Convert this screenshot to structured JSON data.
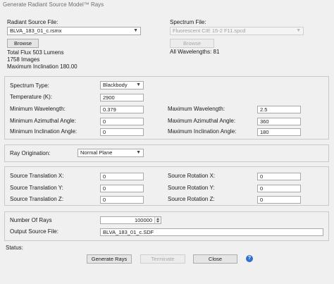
{
  "window": {
    "title": "Generate Radiant Source Model™ Rays"
  },
  "radiant_source": {
    "label": "Radiant Source File:",
    "selected": "BLVA_183_01_c.rsmx",
    "browse_label": "Browse",
    "total_flux": "Total Flux 503 Lumens",
    "images": "1758 Images",
    "max_inclination": "Maximum Inclination 180.00"
  },
  "spectrum_file": {
    "label": "Spectrum File:",
    "selected": "Fluorescent CIE 15-2 F11.spcd",
    "browse_label": "Browse",
    "all_wavelengths": "All Wavelengths: 81"
  },
  "spectrum": {
    "type_label": "Spectrum Type:",
    "type_value": "Blackbody",
    "temperature_label": "Temperature (K):",
    "temperature_value": "2900",
    "min_wavelength_label": "Minimum Wavelength:",
    "min_wavelength_value": "0.379",
    "max_wavelength_label": "Maximum Wavelength:",
    "max_wavelength_value": "2.5",
    "min_azimuthal_label": "Minimum Azimuthal Angle:",
    "min_azimuthal_value": "0",
    "max_azimuthal_label": "Maximum Azimuthal Angle:",
    "max_azimuthal_value": "360",
    "min_inclination_label": "Minimum Inclination Angle:",
    "min_inclination_value": "0",
    "max_inclination_label": "Maximum Inclination Angle:",
    "max_inclination_value": "180"
  },
  "ray_origination": {
    "label": "Ray Origination:",
    "value": "Normal Plane"
  },
  "transform": {
    "tx_label": "Source Translation X:",
    "tx_value": "0",
    "ty_label": "Source Translation Y:",
    "ty_value": "0",
    "tz_label": "Source Translation Z:",
    "tz_value": "0",
    "rx_label": "Source Rotation X:",
    "rx_value": "0",
    "ry_label": "Source Rotation Y:",
    "ry_value": "0",
    "rz_label": "Source Rotation Z:",
    "rz_value": "0"
  },
  "output": {
    "num_rays_label": "Number Of Rays",
    "num_rays_value": "100000",
    "file_label": "Output Source File:",
    "file_value": "BLVA_183_01_c.SDF"
  },
  "status": {
    "label": "Status:"
  },
  "actions": {
    "generate_label": "Generate Rays",
    "terminate_label": "Terminate",
    "close_label": "Close",
    "help_glyph": "?"
  },
  "icons": {
    "dropdown": "chevron-down-icon",
    "help": "help-icon",
    "spinner": "spinner-arrows-icon"
  },
  "colors": {
    "help_blue": "#2f6fcf",
    "window_bg": "#f0f0f0"
  }
}
